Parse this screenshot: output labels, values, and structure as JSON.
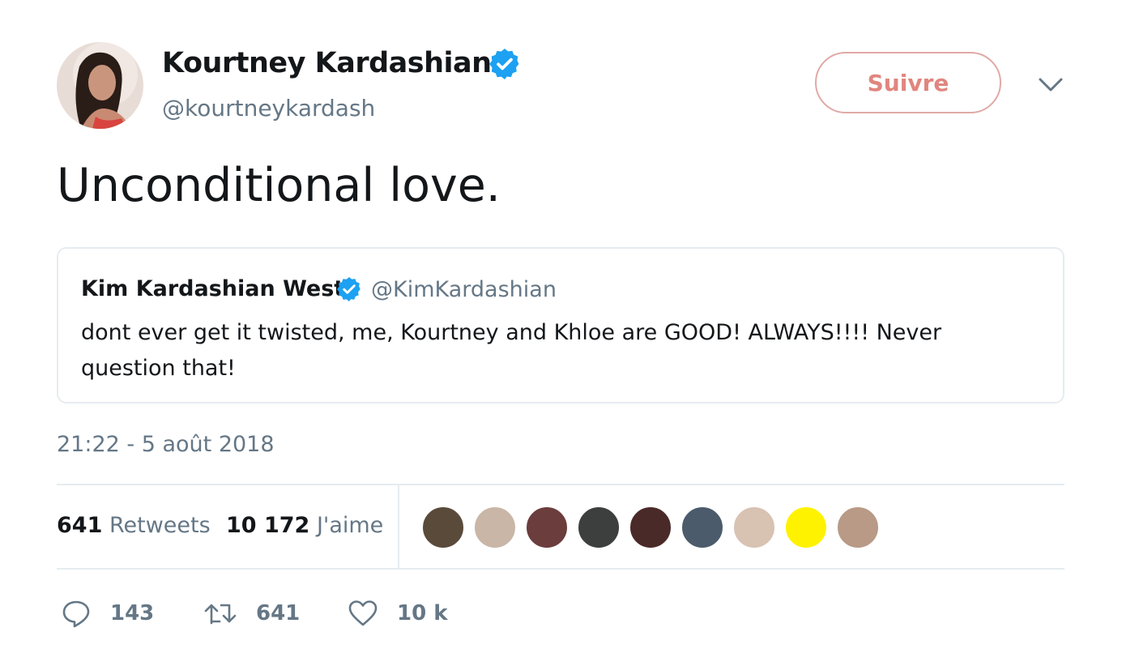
{
  "author": {
    "name": "Kourtney Kardashian",
    "handle": "@kourtneykardash",
    "verified_color": "#1da1f2"
  },
  "follow_button": {
    "label": "Suivre",
    "color": "#e0867f"
  },
  "menu_icon": "chevron-down-icon",
  "tweet": {
    "text": "Unconditional love."
  },
  "quoted_tweet": {
    "name": "Kim Kardashian West",
    "handle": "@KimKardashian",
    "text": "dont ever get it twisted, me, Kourtney and Khloe are GOOD! ALWAYS!!!! Never question that!"
  },
  "timestamp": "21:22 - 5 août 2018",
  "stats": {
    "retweets_count": "641",
    "retweets_label": "Retweets",
    "likes_count": "10 172",
    "likes_label": "J'aime"
  },
  "liker_avatars": [
    {
      "color": "#5a4a3a"
    },
    {
      "color": "#c9b6a6"
    },
    {
      "color": "#6b3d3d"
    },
    {
      "color": "#3d3f3e"
    },
    {
      "color": "#4a2a28"
    },
    {
      "color": "#4b5b6b"
    },
    {
      "color": "#d8c2b2"
    },
    {
      "color": "#fff200"
    },
    {
      "color": "#b89a86"
    }
  ],
  "actions": {
    "reply_count": "143",
    "retweet_count": "641",
    "like_count": "10 k"
  }
}
